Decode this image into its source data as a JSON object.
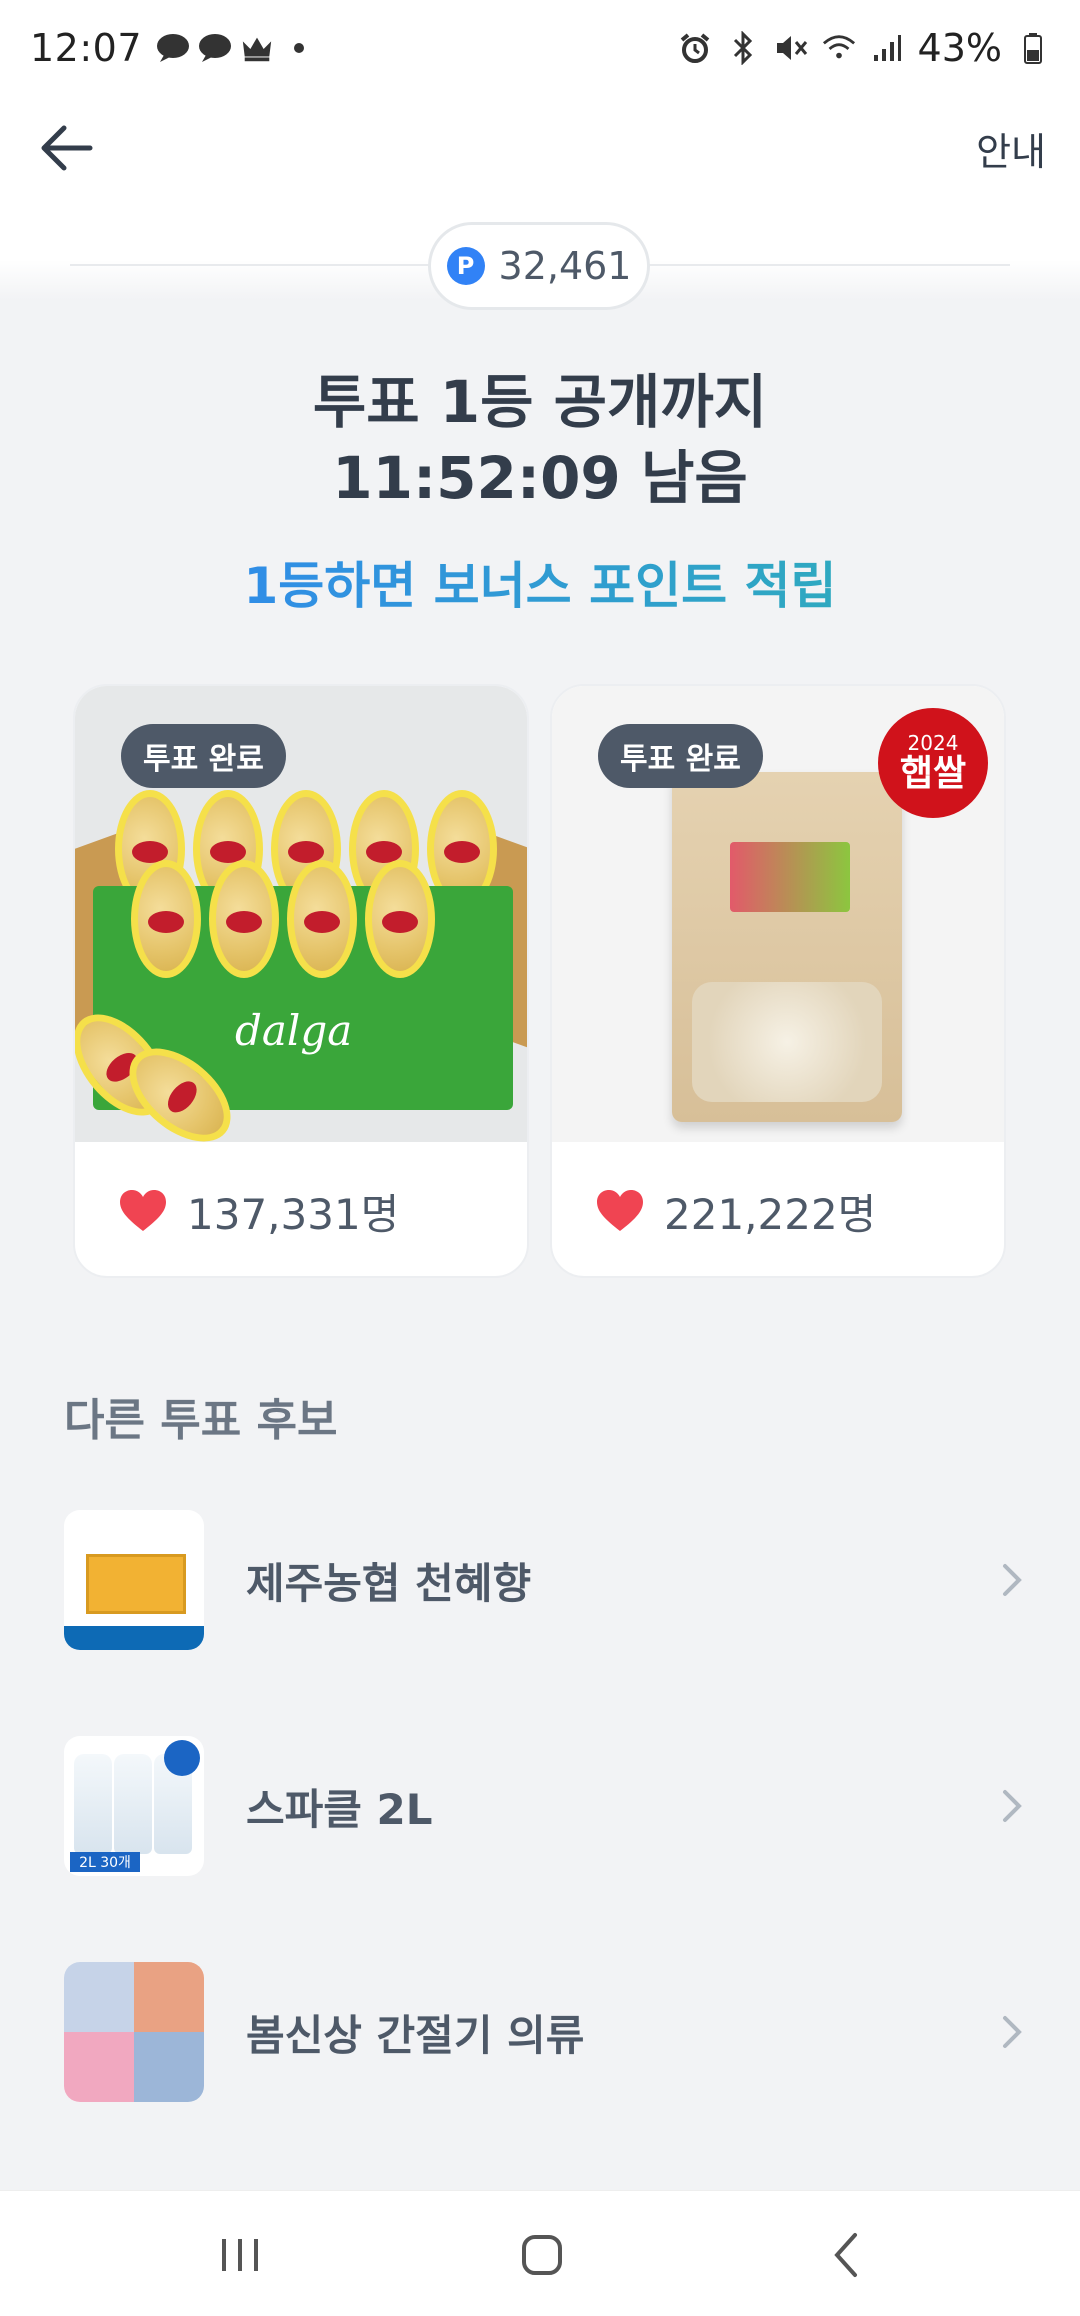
{
  "status_bar": {
    "time": "12:07",
    "battery": "43%"
  },
  "header": {
    "guide_label": "안내"
  },
  "points": {
    "icon_letter": "P",
    "value": "32,461"
  },
  "headline": {
    "line1": "투표 1등 공개까지",
    "line2": "11:52:09 남음",
    "subline": "1등하면 보너스 포인트 적립"
  },
  "vote_cards": [
    {
      "badge": "투표 완료",
      "count": "137,331명",
      "box_brand": "dalga"
    },
    {
      "badge": "투표 완료",
      "count": "221,222명",
      "corner_year": "2024",
      "corner_text": "햅쌀"
    }
  ],
  "other_candidates": {
    "title": "다른 투표 후보",
    "items": [
      {
        "name": "제주농협 천혜향"
      },
      {
        "name": "스파클 2L",
        "thumb_label": "2L 30개"
      },
      {
        "name": "봄신상 간절기 의류"
      }
    ]
  },
  "colors": {
    "accent_blue": "#3182f6",
    "accent_teal": "#2eb4b0",
    "heart": "#f04452",
    "badge": "#4e5968"
  }
}
